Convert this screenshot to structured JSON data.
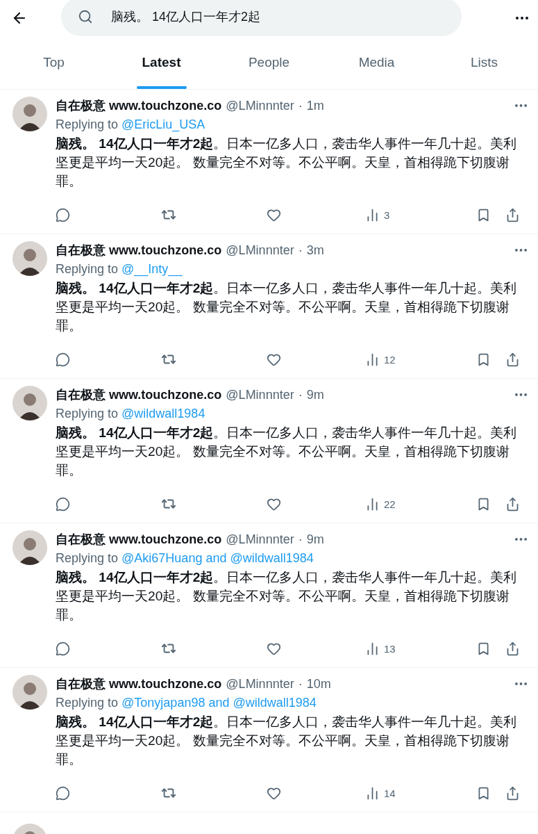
{
  "search": {
    "value": "脑残。 14亿人口一年才2起"
  },
  "tabs": [
    {
      "label": "Top",
      "selected": false
    },
    {
      "label": "Latest",
      "selected": true
    },
    {
      "label": "People",
      "selected": false
    },
    {
      "label": "Media",
      "selected": false
    },
    {
      "label": "Lists",
      "selected": false
    }
  ],
  "tweets": [
    {
      "name": "自在极意 www.touchzone.co",
      "handle": "@LMinnnter",
      "separator": "·",
      "time": "1m",
      "replying_prefix": "Replying to",
      "reply_to": "@EricLiu_USA",
      "text": "**脑残。 14亿人口一年才2起**。日本一亿多人口，袭击华人事件一年几十起。美利坚更是平均一天20起。 数量完全不对等。不公平啊。天皇，首相得跪下切腹谢罪。",
      "views": "3"
    },
    {
      "name": "自在极意 www.touchzone.co",
      "handle": "@LMinnnter",
      "separator": "·",
      "time": "3m",
      "replying_prefix": "Replying to",
      "reply_to": "@__Inty__",
      "text": "**脑残。 14亿人口一年才2起**。日本一亿多人口，袭击华人事件一年几十起。美利坚更是平均一天20起。 数量完全不对等。不公平啊。天皇，首相得跪下切腹谢罪。",
      "views": "12"
    },
    {
      "name": "自在极意 www.touchzone.co",
      "handle": "@LMinnnter",
      "separator": "·",
      "time": "9m",
      "replying_prefix": "Replying to",
      "reply_to": "@wildwall1984",
      "text": "**脑残。 14亿人口一年才2起**。日本一亿多人口，袭击华人事件一年几十起。美利坚更是平均一天20起。 数量完全不对等。不公平啊。天皇，首相得跪下切腹谢罪。",
      "views": "22"
    },
    {
      "name": "自在极意 www.touchzone.co",
      "handle": "@LMinnnter",
      "separator": "·",
      "time": "9m",
      "replying_prefix": "Replying to",
      "reply_to": "@Aki67Huang and @wildwall1984",
      "text": "**脑残。 14亿人口一年才2起**。日本一亿多人口，袭击华人事件一年几十起。美利坚更是平均一天20起。 数量完全不对等。不公平啊。天皇，首相得跪下切腹谢罪。",
      "views": "13"
    },
    {
      "name": "自在极意 www.touchzone.co",
      "handle": "@LMinnnter",
      "separator": "·",
      "time": "10m",
      "replying_prefix": "Replying to",
      "reply_to": "@Tonyjapan98 and @wildwall1984",
      "text": "**脑残。 14亿人口一年才2起**。日本一亿多人口，袭击华人事件一年几十起。美利坚更是平均一天20起。 数量完全不对等。不公平啊。天皇，首相得跪下切腹谢罪。",
      "views": "14"
    }
  ]
}
